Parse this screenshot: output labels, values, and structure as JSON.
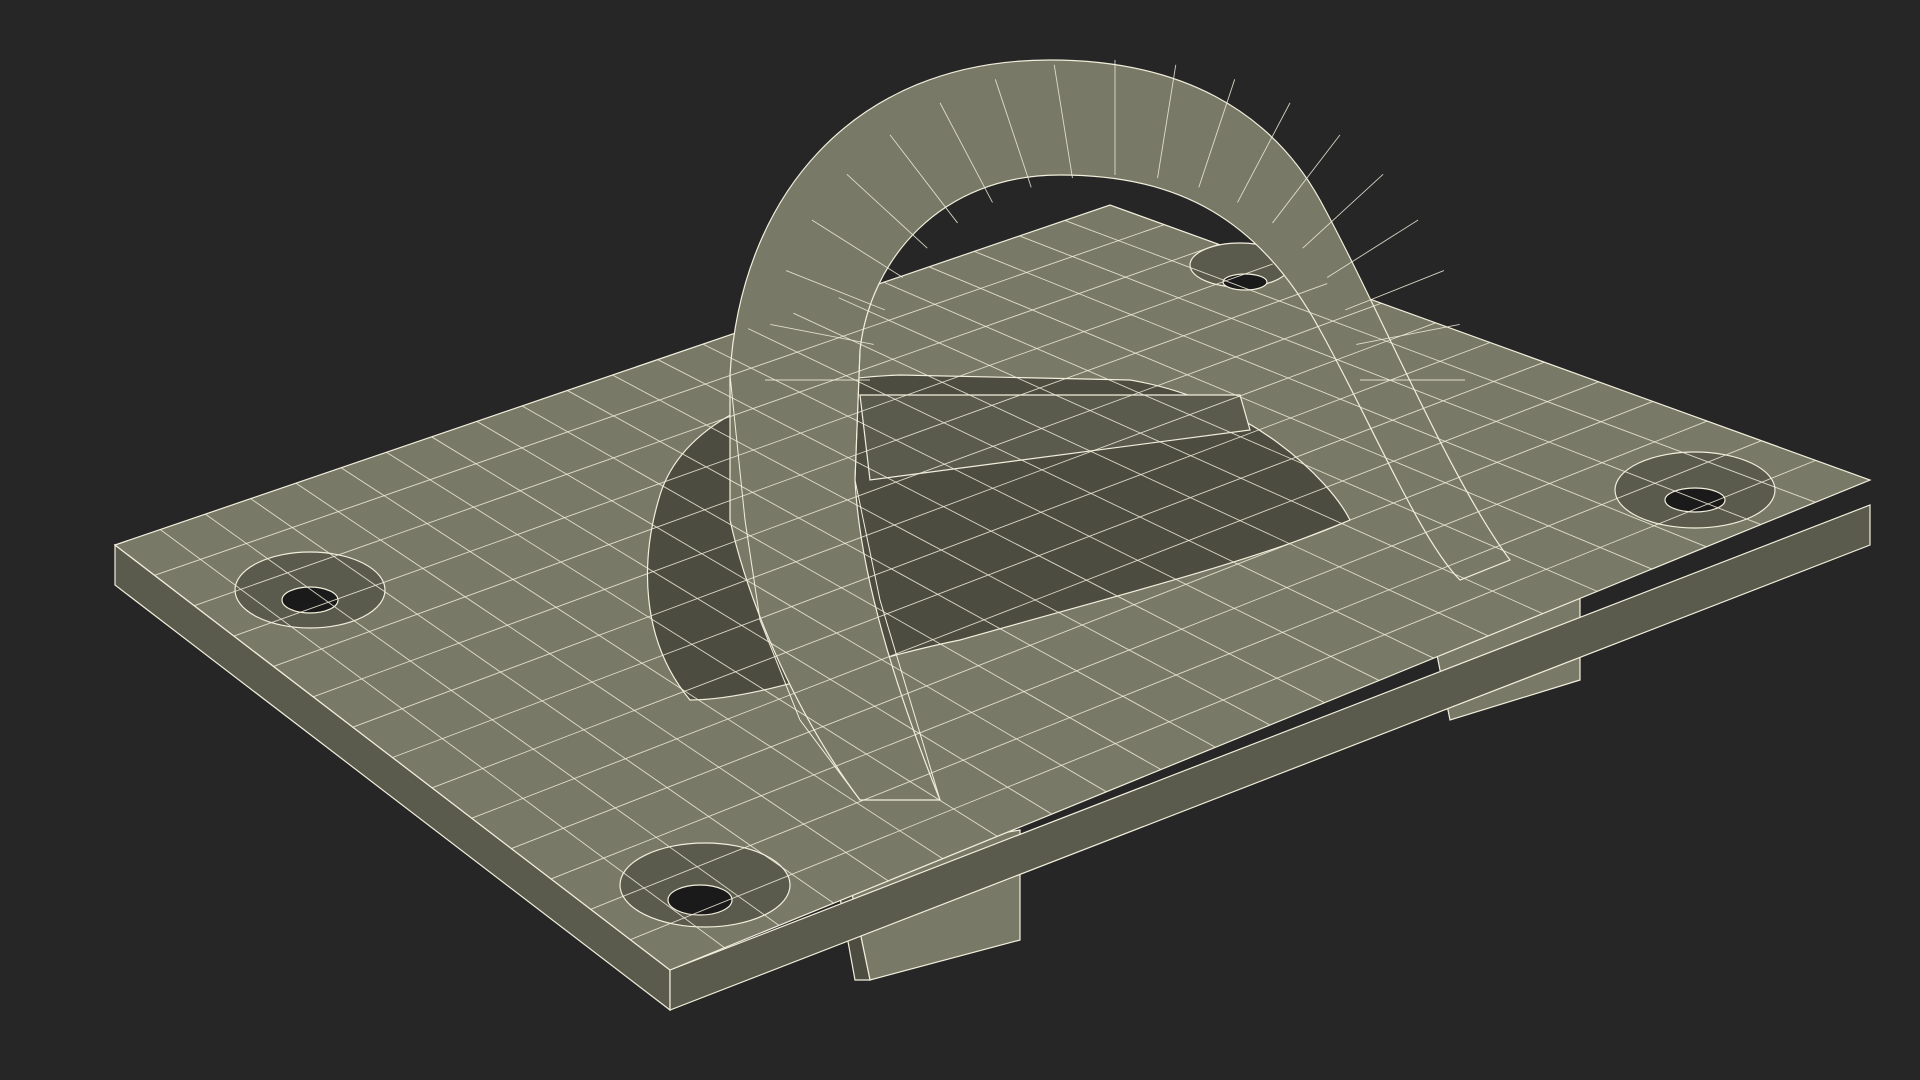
{
  "scene": {
    "background_color": "#262626",
    "surface_color": "#787a67",
    "surface_shadow_color": "#5a5b4c",
    "surface_dark_color": "#4c4d40",
    "wire_color": "#f2eedc",
    "hole_color": "#1a1a1a",
    "objects": [
      {
        "name": "mounting-plate"
      },
      {
        "name": "pad-eye-loop"
      },
      {
        "name": "bolt-hole",
        "count": 4
      },
      {
        "name": "recess-dish"
      },
      {
        "name": "underside-feet",
        "count": 2
      }
    ]
  }
}
